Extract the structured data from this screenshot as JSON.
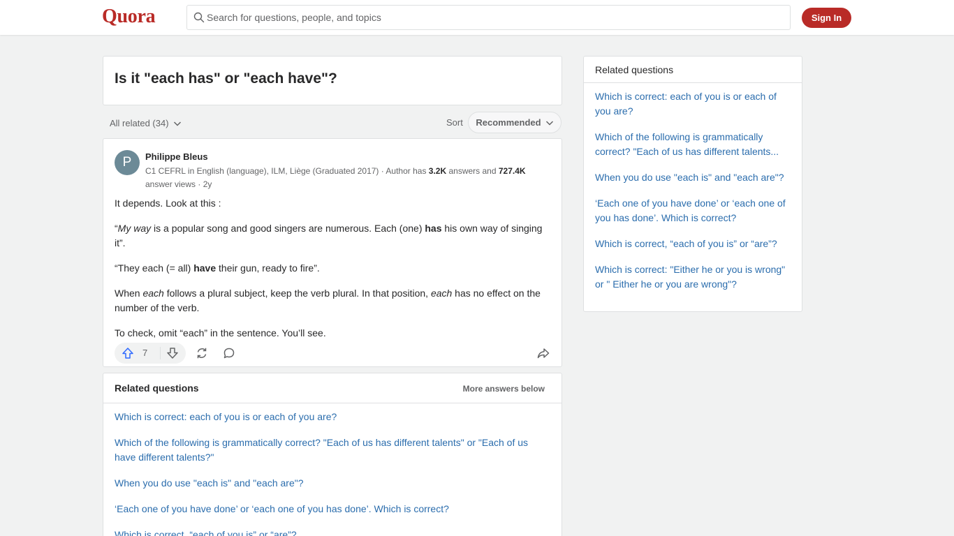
{
  "header": {
    "logo": "Quora",
    "search_placeholder": "Search for questions, people, and topics",
    "signin_label": "Sign In"
  },
  "question": {
    "title": "Is it \"each has\" or \"each have\"?"
  },
  "filters": {
    "all_related": "All related (34)",
    "sort_label": "Sort",
    "sort_value": "Recommended"
  },
  "answer": {
    "avatar_letter": "P",
    "author": "Philippe Bleus",
    "cred_prefix": "C1 CEFRL in English (language), ILM, Liège (Graduated 2017) · Author has ",
    "answers_count": "3.2K",
    "cred_mid": " answers and ",
    "views_count": "727.4K",
    "cred_suffix": " answer views · 2y",
    "p1": "It depends. Look at this :",
    "p2_open": "“",
    "p2_italic": "My way",
    "p2_a": " is a popular song and good singers are numerous. Each (one) ",
    "p2_bold": "has",
    "p2_b": " his own way of singing it”.",
    "p3_a": "“They each (= all) ",
    "p3_bold": "have",
    "p3_b": " their gun, ready to fire”.",
    "p4_a": "When ",
    "p4_i1": "each",
    "p4_b": " follows a plural subject, keep the verb plural. In that position, ",
    "p4_i2": "each",
    "p4_c": " has no effect on the number of the verb.",
    "p5": "To check, omit “each” in the sentence. You’ll see.",
    "upvotes": "7"
  },
  "related_main": {
    "title": "Related questions",
    "more": "More answers below",
    "items": [
      "Which is correct: each of you is or each of you are?",
      "Which of the following is grammatically correct? \"Each of us has different talents\" or \"Each of us have different talents?\"",
      "When you do use \"each is\" and \"each are\"?",
      "‘Each one of you have done’ or ‘each one of you has done’. Which is correct?",
      "Which is correct, “each of you is” or “are”?"
    ]
  },
  "sidebar": {
    "title": "Related questions",
    "items": [
      "Which is correct: each of you is or each of you are?",
      "Which of the following is grammatically correct? \"Each of us has different talents...",
      "When you do use \"each is\" and \"each are\"?",
      "‘Each one of you have done’ or ‘each one of you has done’. Which is correct?",
      "Which is correct, “each of you is” or “are”?",
      "Which is correct: \"Either he or you is wrong\" or \" Either he or you are wrong\"?"
    ]
  },
  "colors": {
    "brand": "#b92b27",
    "link": "#2b6dad",
    "upvote": "#2e69ff"
  }
}
